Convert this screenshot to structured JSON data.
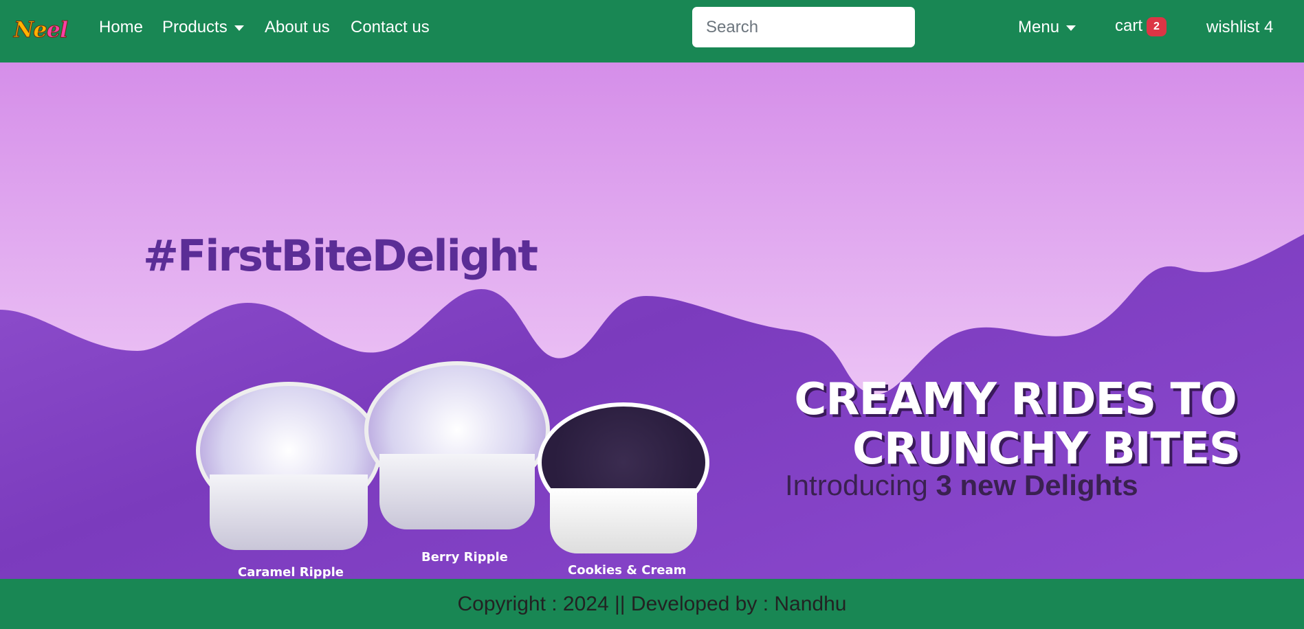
{
  "nav": {
    "logo": "Neel",
    "links": [
      "Home",
      "Products",
      "About us",
      "Contact us"
    ],
    "search_placeholder": "Search",
    "menu": "Menu",
    "cart": "cart",
    "cart_count": "2",
    "wishlist": "wishlist 4"
  },
  "banner": {
    "hashtag": "#FirstBiteDelight",
    "headline_1": "CREAMY RIDES TO",
    "headline_2": "CRUNCHY BITES",
    "intro_prefix": "Introducing ",
    "intro_bold": "3 new Delights",
    "products": [
      "Caramel Ripple",
      "Berry Ripple",
      "Cookies & Cream"
    ],
    "colors": {
      "drip": "#d58ee9",
      "base": "#7b3bbd"
    }
  },
  "footer": {
    "text": "Copyright : 2024 || Developed by : Nandhu"
  }
}
